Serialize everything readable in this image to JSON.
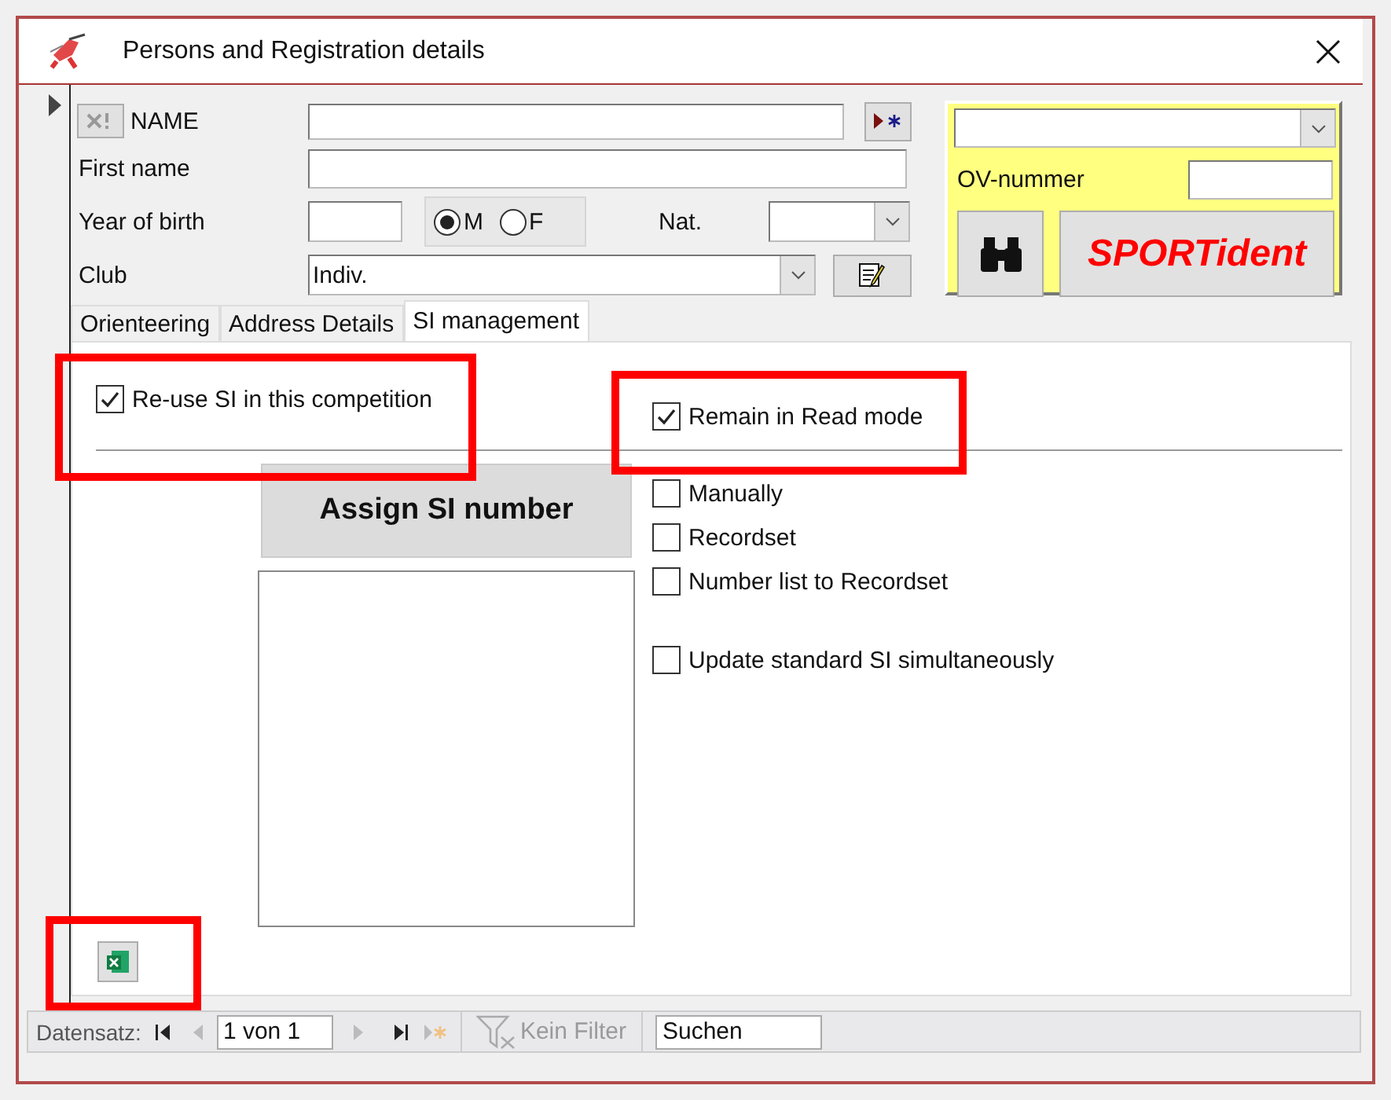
{
  "window": {
    "title": "Persons and Registration details"
  },
  "form": {
    "name_label": "NAME",
    "first_name_label": "First name",
    "year_label": "Year of birth",
    "sex": [
      {
        "label": "M",
        "selected": true
      },
      {
        "label": "F",
        "selected": false
      }
    ],
    "nat_label": "Nat.",
    "club_label": "Club",
    "club_value": "Indiv."
  },
  "si_panel": {
    "ov_label": "OV-nummer",
    "sportident_button": "SPORTident"
  },
  "tabs": [
    {
      "label": "Orienteering",
      "selected": false
    },
    {
      "label": "Address Details",
      "selected": false
    },
    {
      "label": "SI management",
      "selected": true
    }
  ],
  "si_management": {
    "top_options": [
      {
        "label": "Re-use SI in this competition",
        "checked": true,
        "highlighted": true
      },
      {
        "label": "Remain in Read mode",
        "checked": true,
        "highlighted": true
      }
    ],
    "assign_button": "Assign SI number",
    "options": [
      {
        "label": "Manually",
        "checked": false
      },
      {
        "label": "Recordset",
        "checked": false
      },
      {
        "label": "Number list to Recordset",
        "checked": false
      },
      {
        "label": "Update standard SI simultaneously",
        "checked": false
      }
    ],
    "excel_button": {
      "highlighted": true
    }
  },
  "status_bar": {
    "label": "Datensatz:",
    "position": "1 von 1",
    "filter": {
      "label": "Kein Filter",
      "disabled": true
    },
    "search": "Suchen"
  }
}
